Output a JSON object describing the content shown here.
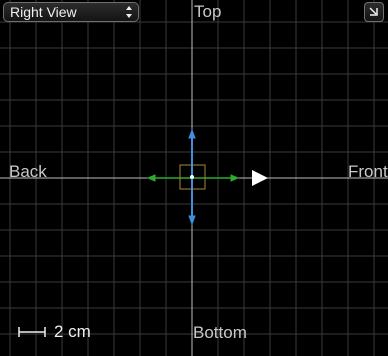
{
  "view_selector": {
    "value": "Right View",
    "icon": "up-down-arrows-icon"
  },
  "axis_labels": {
    "top": "Top",
    "back": "Back",
    "front": "Front",
    "bottom": "Bottom"
  },
  "scale": {
    "label": "2 cm"
  },
  "maximize": {
    "icon": "maximize-icon"
  },
  "colors": {
    "background": "#000000",
    "grid": "#3a3a3a",
    "axis": "#bdbdbd",
    "vertical_handle": "#3f8fe0",
    "horizontal_handle": "#2eab2e",
    "selection_box": "#a08a3a",
    "arrow": "#ffffff"
  }
}
